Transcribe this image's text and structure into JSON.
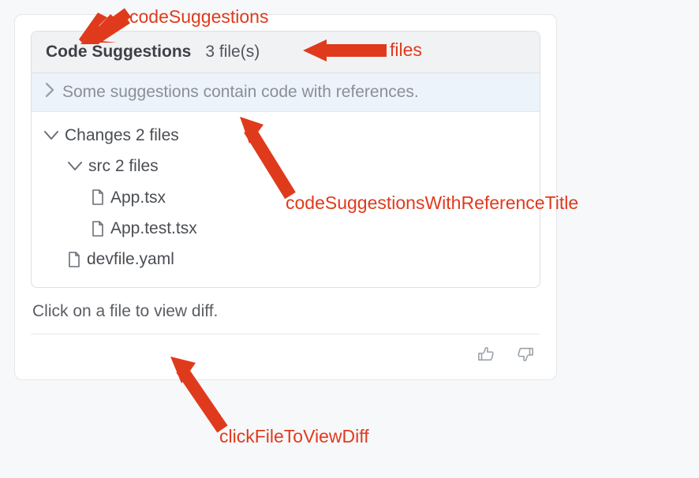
{
  "header": {
    "title": "Code Suggestions",
    "file_count_label": "3 file(s)"
  },
  "references_banner": "Some suggestions contain code with references.",
  "tree": {
    "root_label": "Changes 2 files",
    "folder_label": "src 2 files",
    "files_in_folder": [
      "App.tsx",
      "App.test.tsx"
    ],
    "root_files": [
      "devfile.yaml"
    ]
  },
  "hint": "Click on a file to view diff.",
  "annotations": {
    "codeSuggestions": "codeSuggestions",
    "files": "files",
    "codeSuggestionsWithReferenceTitle": "codeSuggestionsWithReferenceTitle",
    "clickFileToViewDiff": "clickFileToViewDiff"
  }
}
